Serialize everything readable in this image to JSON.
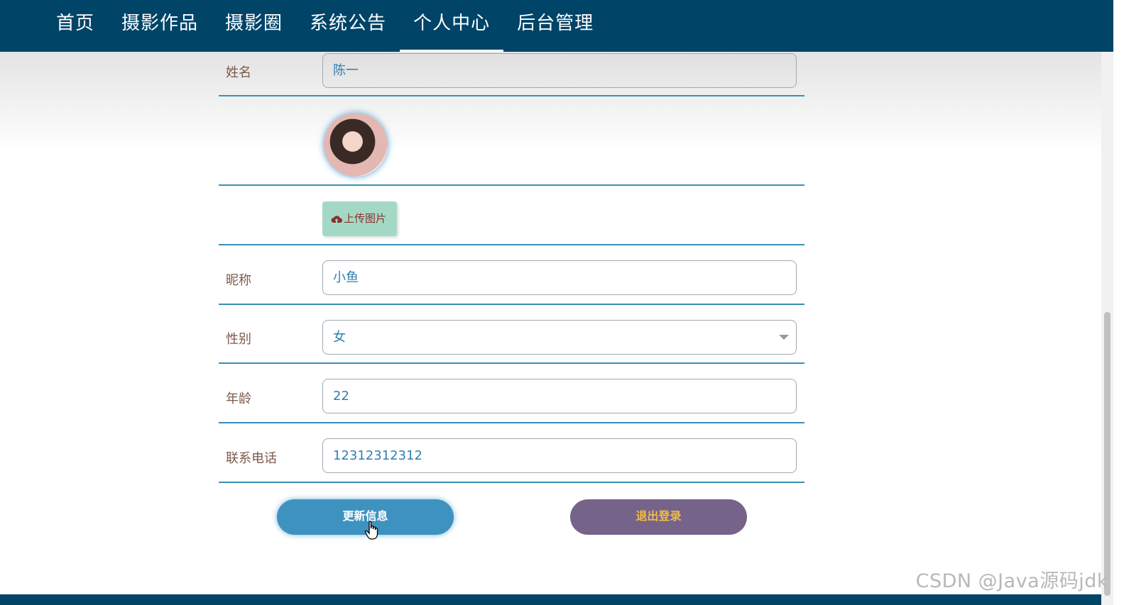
{
  "nav": {
    "items": [
      {
        "label": "首页"
      },
      {
        "label": "摄影作品"
      },
      {
        "label": "摄影圈"
      },
      {
        "label": "系统公告"
      },
      {
        "label": "个人中心",
        "active": true
      },
      {
        "label": "后台管理"
      }
    ]
  },
  "form": {
    "name": {
      "label": "姓名",
      "value": "陈一"
    },
    "upload": {
      "label": "上传图片",
      "icon": "cloud-upload-icon"
    },
    "nickname": {
      "label": "昵称",
      "value": "小鱼"
    },
    "gender": {
      "label": "性别",
      "value": "女"
    },
    "age": {
      "label": "年龄",
      "value": "22"
    },
    "phone": {
      "label": "联系电话",
      "value": "12312312312"
    }
  },
  "actions": {
    "update_label": "更新信息",
    "logout_label": "退出登录"
  },
  "watermark": "CSDN @Java源码jdk",
  "colors": {
    "nav_bg": "#004468",
    "divider": "#3b8fb5",
    "label": "#7a5a4c",
    "value": "#2f7fb0",
    "upload_bg": "#a3d9c4",
    "update_bg": "#3e92c0",
    "logout_bg": "#76638a",
    "logout_text": "#f2bb46"
  }
}
